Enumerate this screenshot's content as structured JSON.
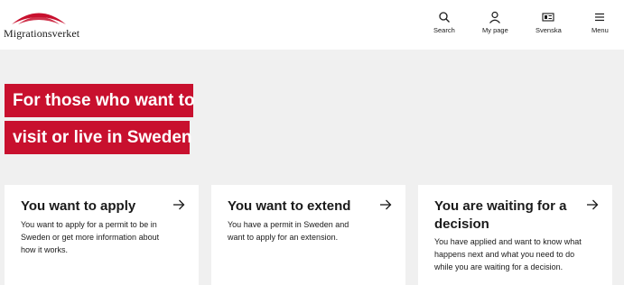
{
  "header": {
    "logo_text": "Migrationsverket",
    "nav": [
      {
        "label": "Search",
        "icon": "search-icon"
      },
      {
        "label": "My page",
        "icon": "user-icon"
      },
      {
        "label": "Svenska",
        "icon": "language-icon"
      },
      {
        "label": "Menu",
        "icon": "menu-icon"
      }
    ]
  },
  "hero": {
    "line1": "For those who want to",
    "line2": "visit or live in Sweden"
  },
  "cards": [
    {
      "title": "You want to apply",
      "description": "You want to apply for a permit to be in Sweden or get more information about how it works."
    },
    {
      "title": "You want to extend",
      "description": "You have a permit in Sweden and want to apply for an extension."
    },
    {
      "title": "You are waiting for a decision",
      "description": "You have applied and want to know what happens next and what you need to do while you are waiting for a decision."
    }
  ],
  "colors": {
    "accent": "#c8102e",
    "background": "#f0f0f0",
    "card": "#ffffff"
  }
}
